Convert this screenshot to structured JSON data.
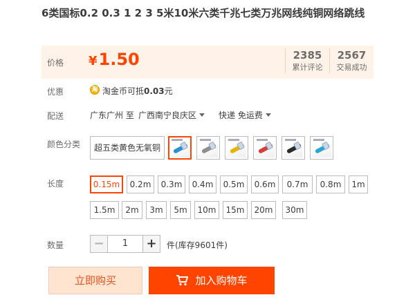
{
  "product": {
    "title": "6类国标0.2 0.3 1 2 3 5米10米六类千兆七类万兆网线纯铜网络跳线"
  },
  "price": {
    "label": "价格",
    "currency": "¥",
    "value": "1.50",
    "stats": [
      {
        "number": "2385",
        "label": "累计评论"
      },
      {
        "number": "2567",
        "label": "交易成功"
      }
    ]
  },
  "promo": {
    "label": "优惠",
    "coin_glyph": "淘",
    "text_prefix": "淘金币可抵",
    "amount": "0.03",
    "unit": "元"
  },
  "shipping": {
    "label": "配送",
    "from": "广东广州 至",
    "to": "广西南宁良庆区",
    "method": "快递 免运费"
  },
  "color": {
    "label": "颜色分类",
    "text_option": "超五类黄色无氧铜",
    "swatch_colors": [
      "#2a8fd8",
      "#8e8e8e",
      "#e8b400",
      "#d93a3a",
      "#2b2b2b",
      "#27a6d9"
    ],
    "selected_index": 0
  },
  "length": {
    "label": "长度",
    "options": [
      "0.15m",
      "0.2m",
      "0.3m",
      "0.4m",
      "0.5m",
      "0.6m",
      "0.7m",
      "0.8m",
      "1m",
      "1.5m",
      "2m",
      "3m",
      "5m",
      "10m",
      "15m",
      "20m",
      "30m"
    ],
    "selected_index": 0
  },
  "quantity": {
    "label": "数量",
    "minus": "−",
    "value": "1",
    "plus": "+",
    "stock": "件(库存9601件)"
  },
  "actions": {
    "buy_now": "立即购买",
    "add_to_cart": "加入购物车"
  },
  "colors": {
    "accent": "#ff4400",
    "price_bg": "#fff2e8",
    "buy_now_bg": "#ffe4d0"
  }
}
